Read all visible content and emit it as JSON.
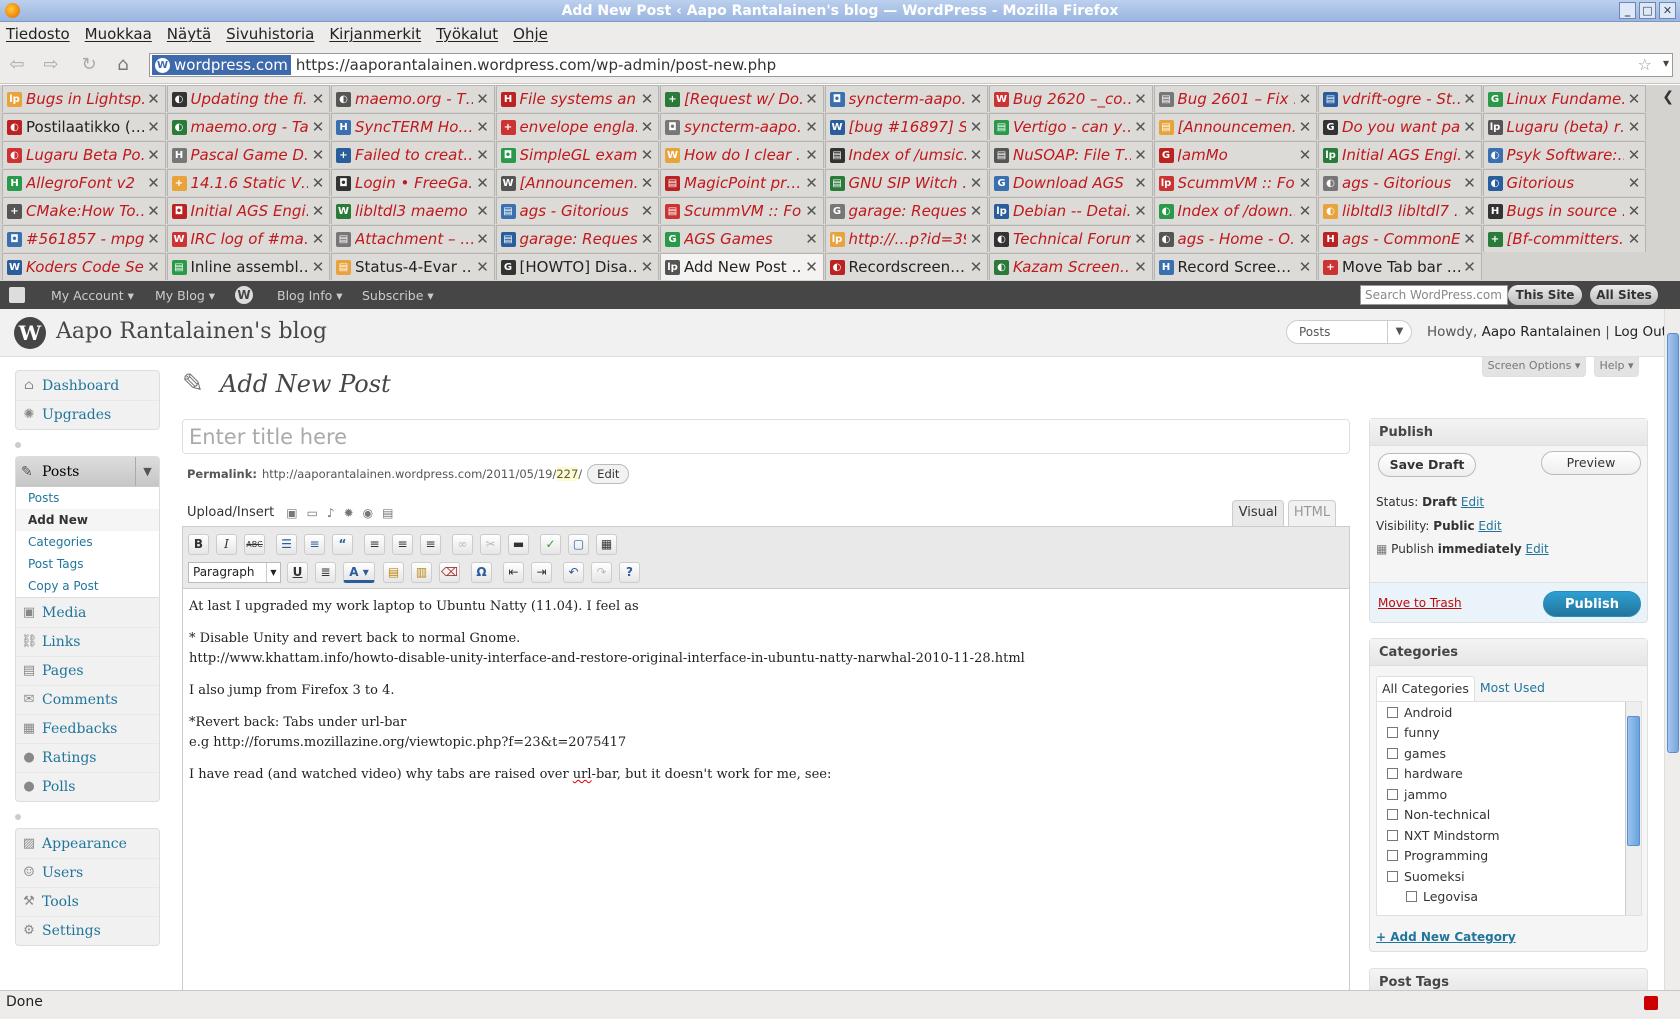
{
  "window": {
    "title": "Add New Post ‹ Aapo Rantalainen's blog — WordPress - Mozilla Firefox"
  },
  "menu": [
    "Tiedosto",
    "Muokkaa",
    "Näytä",
    "Sivuhistoria",
    "Kirjanmerkit",
    "Työkalut",
    "Ohje"
  ],
  "urlbar": {
    "identity": "wordpress.com",
    "url": "https://aaporantalainen.wordpress.com/wp-admin/post-new.php"
  },
  "tabs": [
    [
      "Bugs in Lightsp…",
      "Updating the fi…",
      "maemo.org - T…",
      "File systems an…",
      "[Request w/ Do…",
      "syncterm-aapo…",
      "Bug 2620 –_co…",
      "Bug 2601 – Fix …",
      "vdrift-ogre - St…",
      "Linux Fundame…"
    ],
    [
      "Postilaatikko (…",
      "maemo.org - Talk",
      "SyncTERM Ho…",
      "envelope engla…",
      "syncterm-aapo…",
      "[bug #16897] S…",
      "Vertigo - can y…",
      "[Announcemen…",
      "Do you want pa…",
      "Lugaru (beta) r…"
    ],
    [
      "Lugaru Beta Po…",
      "Pascal Game D…",
      "Failed to creat…",
      "SimpleGL exam…",
      "How do I clear …",
      "Index of /umsic…",
      "NuSOAP: File T…",
      "JamMo",
      "Initial AGS Engi…",
      "Psyk Software:…"
    ],
    [
      "AllegroFont v2",
      "14.1.6 Static V…",
      "Login • FreeGa…",
      "[Announcemen…",
      "MagicPoint pr…",
      "GNU SIP Witch …",
      "Download AGS",
      "ScummVM :: Fo…",
      "ags - Gitorious",
      "Gitorious"
    ],
    [
      "CMake:How To…",
      "Initial AGS Engi…",
      "libltdl3 maemo …",
      "ags - Gitorious",
      "ScummVM :: Fo…",
      "garage: Reques…",
      "Debian -- Detai…",
      "Index of /down…",
      "libltdl3 libltdl7 …",
      "Bugs in source …"
    ],
    [
      "#561857 - mpg…",
      "IRC log of #ma…",
      "Attachment – …",
      "garage: Reques…",
      "AGS Games",
      "http://…p?id=39",
      "Technical Forum",
      "ags - Home - O…",
      "ags - CommonE…",
      "[Bf-committers…"
    ],
    [
      "Koders Code Se…",
      "Inline assembl…",
      "Status-4-Evar …",
      "[HOWTO] Disa…",
      "Add New Post …",
      "Recordscreen.…",
      "Kazam Screen…",
      "Record Scree…",
      "Move Tab bar …"
    ]
  ],
  "tab_scroll_icon": "chevron-left-icon",
  "wpbar": {
    "account": "My Account ▾",
    "myblog": "My Blog ▾",
    "bloginfo": "Blog Info ▾",
    "subscribe": "Subscribe ▾",
    "search_placeholder": "Search WordPress.com",
    "this_site": "This Site",
    "all_sites": "All Sites"
  },
  "header": {
    "blog_name": "Aapo Rantalainen's blog",
    "favorites": "Posts",
    "howdy": "Howdy,",
    "user": "Aapo Rantalainen",
    "sep": "|",
    "logout": "Log Out"
  },
  "screen_options": "Screen Options ▾",
  "help": "Help ▾",
  "sidebar": {
    "top": [
      {
        "label": "Dashboard",
        "icon": "dashboard-icon"
      },
      {
        "label": "Upgrades",
        "icon": "upgrades-icon"
      }
    ],
    "posts_label": "Posts",
    "posts_sub": [
      "Posts",
      "Add New",
      "Categories",
      "Post Tags",
      "Copy a Post"
    ],
    "content": [
      {
        "label": "Media",
        "icon": "media-icon"
      },
      {
        "label": "Links",
        "icon": "links-icon"
      },
      {
        "label": "Pages",
        "icon": "pages-icon"
      },
      {
        "label": "Comments",
        "icon": "comments-icon"
      },
      {
        "label": "Feedbacks",
        "icon": "feedbacks-icon"
      },
      {
        "label": "Ratings",
        "icon": "ratings-icon"
      },
      {
        "label": "Polls",
        "icon": "polls-icon"
      }
    ],
    "settings": [
      {
        "label": "Appearance",
        "icon": "appearance-icon"
      },
      {
        "label": "Users",
        "icon": "users-icon"
      },
      {
        "label": "Tools",
        "icon": "tools-icon"
      },
      {
        "label": "Settings",
        "icon": "settings-icon"
      }
    ]
  },
  "page": {
    "title": "Add New Post",
    "title_placeholder": "Enter title here",
    "permalink_label": "Permalink:",
    "permalink_base": "http://aaporantalainen.wordpress.com/2011/05/19/",
    "permalink_slug": "227",
    "permalink_end": "/",
    "edit": "Edit",
    "upload": "Upload/Insert",
    "visual": "Visual",
    "html": "HTML",
    "format": "Paragraph"
  },
  "post_content": [
    "At last I upgraded my work laptop to Ubuntu Natty (11.04). I feel as",
    "* Disable Unity and revert back to normal Gnome.",
    "http://www.khattam.info/howto-disable-unity-interface-and-restore-original-interface-in-ubuntu-natty-narwhal-2010-11-28.html",
    "I also jump from Firefox 3 to 4.",
    "*Revert back: Tabs under url-bar",
    "e.g http://forums.mozillazine.org/viewtopic.php?f=23&t=2075417",
    "I have read (and watched video) why tabs are raised over ",
    "url",
    "-bar, but it doesn't work for me, see:"
  ],
  "publish": {
    "title": "Publish",
    "save_draft": "Save Draft",
    "preview": "Preview",
    "status_label": "Status:",
    "status": "Draft",
    "visibility_label": "Visibility:",
    "visibility": "Public",
    "publish_label": "Publish",
    "publish_when": "immediately",
    "edit": "Edit",
    "trash": "Move to Trash",
    "publish_btn": "Publish"
  },
  "categories": {
    "title": "Categories",
    "tab_all": "All Categories",
    "tab_used": "Most Used",
    "items": [
      "Android",
      "funny",
      "games",
      "hardware",
      "jammo",
      "Non-technical",
      "NXT Mindstorm",
      "Programming",
      "Suomeksi"
    ],
    "child": "Legovisa",
    "add": "+ Add New Category"
  },
  "post_tags": {
    "title": "Post Tags"
  },
  "status": "Done"
}
